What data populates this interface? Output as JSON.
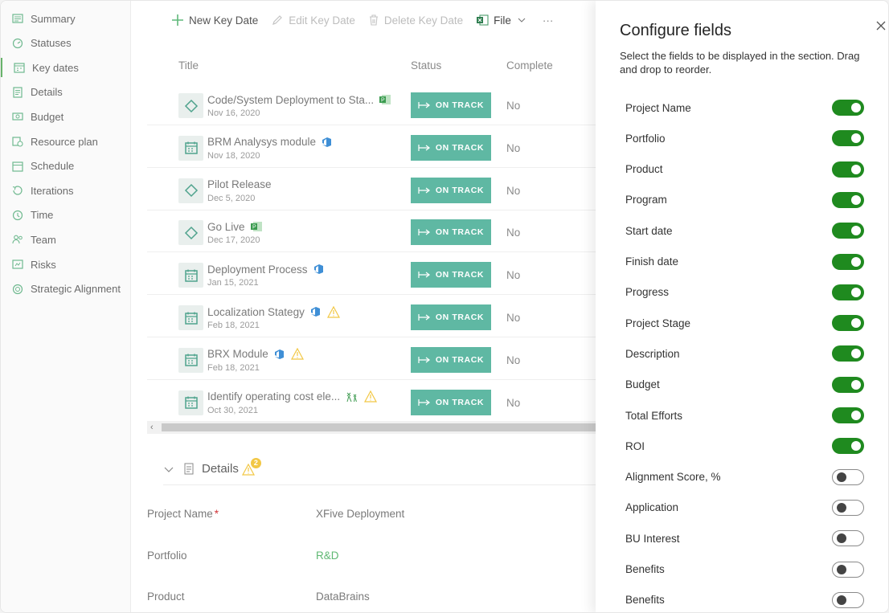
{
  "sidebar": {
    "items": [
      {
        "label": "Summary",
        "icon": "summary-icon"
      },
      {
        "label": "Statuses",
        "icon": "statuses-icon"
      },
      {
        "label": "Key dates",
        "icon": "key-dates-icon",
        "active": true
      },
      {
        "label": "Details",
        "icon": "details-icon"
      },
      {
        "label": "Budget",
        "icon": "budget-icon"
      },
      {
        "label": "Resource plan",
        "icon": "resource-plan-icon"
      },
      {
        "label": "Schedule",
        "icon": "schedule-icon"
      },
      {
        "label": "Iterations",
        "icon": "iterations-icon"
      },
      {
        "label": "Time",
        "icon": "time-icon"
      },
      {
        "label": "Team",
        "icon": "team-icon"
      },
      {
        "label": "Risks",
        "icon": "risks-icon"
      },
      {
        "label": "Strategic Alignment",
        "icon": "strategic-alignment-icon"
      }
    ]
  },
  "toolbar": {
    "new_label": "New Key Date",
    "edit_label": "Edit Key Date",
    "delete_label": "Delete Key Date",
    "file_label": "File",
    "more_label": "···"
  },
  "table": {
    "columns": [
      "Title",
      "Status",
      "Complete"
    ],
    "rows": [
      {
        "title": "Code/System Deployment to Sta...",
        "date": "Nov 16, 2020",
        "type": "milestone",
        "badges": [
          "project-icon"
        ],
        "status": "ON TRACK",
        "complete": "No"
      },
      {
        "title": "BRM Analysys module",
        "date": "Nov 18, 2020",
        "type": "calendar",
        "badges": [
          "azure-devops-icon"
        ],
        "status": "ON TRACK",
        "complete": "No"
      },
      {
        "title": "Pilot Release",
        "date": "Dec 5, 2020",
        "type": "milestone",
        "badges": [],
        "status": "ON TRACK",
        "complete": "No"
      },
      {
        "title": "Go Live",
        "date": "Dec 17, 2020",
        "type": "milestone",
        "badges": [
          "project-icon"
        ],
        "status": "ON TRACK",
        "complete": "No"
      },
      {
        "title": "Deployment Process",
        "date": "Jan 15, 2021",
        "type": "calendar",
        "badges": [
          "azure-devops-icon"
        ],
        "status": "ON TRACK",
        "complete": "No"
      },
      {
        "title": "Localization Stategy",
        "date": "Feb 18, 2021",
        "type": "calendar",
        "badges": [
          "azure-devops-icon",
          "warning-icon"
        ],
        "status": "ON TRACK",
        "complete": "No"
      },
      {
        "title": "BRX Module",
        "date": "Feb 18, 2021",
        "type": "calendar",
        "badges": [
          "azure-devops-icon",
          "warning-icon"
        ],
        "status": "ON TRACK",
        "complete": "No"
      },
      {
        "title": "Identify operating cost ele...",
        "date": "Oct 30, 2021",
        "type": "calendar",
        "badges": [
          "wind-icon",
          "warning-icon"
        ],
        "status": "ON TRACK",
        "complete": "No"
      }
    ]
  },
  "details": {
    "title": "Details",
    "badge_count": "2",
    "fields": [
      {
        "label": "Project Name",
        "required": true,
        "value": "XFive Deployment",
        "link": false
      },
      {
        "label": "Portfolio",
        "required": false,
        "value": "R&D",
        "link": true
      },
      {
        "label": "Product",
        "required": false,
        "value": "DataBrains",
        "link": false
      }
    ]
  },
  "panel": {
    "title": "Configure fields",
    "description": "Select the fields to be displayed in the section. Drag and drop to reorder.",
    "fields": [
      {
        "label": "Project Name",
        "on": true
      },
      {
        "label": "Portfolio",
        "on": true
      },
      {
        "label": "Product",
        "on": true
      },
      {
        "label": "Program",
        "on": true
      },
      {
        "label": "Start date",
        "on": true
      },
      {
        "label": "Finish date",
        "on": true
      },
      {
        "label": "Progress",
        "on": true
      },
      {
        "label": "Project Stage",
        "on": true
      },
      {
        "label": "Description",
        "on": true
      },
      {
        "label": "Budget",
        "on": true
      },
      {
        "label": "Total Efforts",
        "on": true
      },
      {
        "label": "ROI",
        "on": true
      },
      {
        "label": "Alignment Score, %",
        "on": false
      },
      {
        "label": "Application",
        "on": false
      },
      {
        "label": "BU Interest",
        "on": false
      },
      {
        "label": "Benefits",
        "on": false
      },
      {
        "label": "Benefits",
        "on": false
      }
    ]
  },
  "colors": {
    "accent": "#5fb8a3",
    "toggle_on": "#1f8a1f",
    "sidebar_icon": "#6fb98f",
    "link": "#5fb873",
    "warning": "#f2c744"
  }
}
